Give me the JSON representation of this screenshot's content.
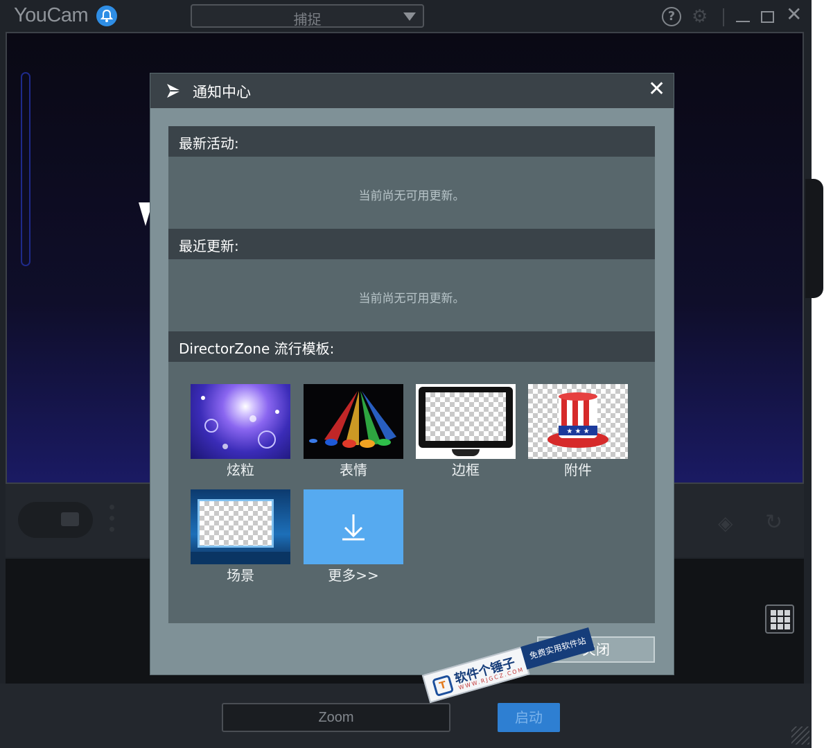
{
  "app": {
    "logo_text": "YouCam",
    "mode_select_value": "捕捉",
    "help_label": "?"
  },
  "dialog": {
    "title": "通知中心",
    "sections": {
      "latest_activity": {
        "heading": "最新活动:",
        "empty_message": "当前尚无可用更新。"
      },
      "recent_updates": {
        "heading": "最近更新:",
        "empty_message": "当前尚无可用更新。"
      },
      "directorzone": {
        "heading": "DirectorZone 流行模板:"
      }
    },
    "templates": [
      {
        "label": "炫粒",
        "icon": "particle-thumbnail"
      },
      {
        "label": "表情",
        "icon": "emotion-thumbnail"
      },
      {
        "label": "边框",
        "icon": "frame-thumbnail"
      },
      {
        "label": "附件",
        "icon": "accessory-thumbnail"
      },
      {
        "label": "场景",
        "icon": "scene-thumbnail"
      },
      {
        "label": "更多>>",
        "icon": "download-icon"
      }
    ],
    "close_button": "关闭"
  },
  "bottom": {
    "zoom_label": "Zoom",
    "start_button": "启动"
  },
  "watermark": {
    "logo": "T",
    "name": "软件个锤子",
    "url": "WWW.RJGCZ.COM",
    "slogan": "免费实用软件站"
  },
  "colors": {
    "accent_blue": "#2f8ee5",
    "dialog_body": "#7f9197",
    "dialog_header": "#3a4248",
    "more_tile": "#56aaf0"
  }
}
